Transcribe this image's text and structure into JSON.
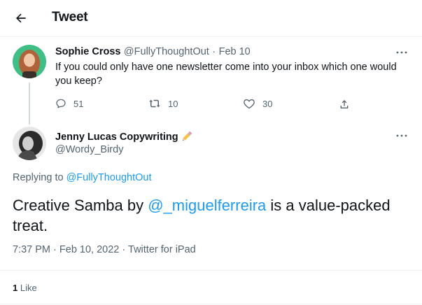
{
  "header": {
    "title": "Tweet"
  },
  "parent_tweet": {
    "display_name": "Sophie Cross",
    "handle": "@FullyThoughtOut",
    "separator": "·",
    "date": "Feb 10",
    "text": "If you could only have one newsletter come into your inbox which one would you keep?",
    "replies": "51",
    "retweets": "10",
    "likes": "30"
  },
  "main_tweet": {
    "display_name": "Jenny Lucas Copywriting",
    "handle": "@Wordy_Birdy",
    "replying_prefix": "Replying to",
    "replying_handle": "@FullyThoughtOut",
    "text_before": "Creative Samba by ",
    "mention": "@_miguelferreira",
    "text_after": " is a value-packed treat.",
    "time": "7:37 PM",
    "sep1": "·",
    "date": "Feb 10, 2022",
    "sep2": "·",
    "source": "Twitter for iPad",
    "like_count": "1",
    "like_label": "Like"
  },
  "icons": {
    "back": "arrow-left-icon",
    "more": "more-horizontal-icon",
    "reply": "reply-icon",
    "retweet": "retweet-icon",
    "like": "heart-icon",
    "share": "share-icon",
    "pencil": "pencil-emoji"
  },
  "colors": {
    "accent": "#1d9bf0",
    "muted": "#536471",
    "text": "#0f1419",
    "divider": "#eff3f4"
  }
}
